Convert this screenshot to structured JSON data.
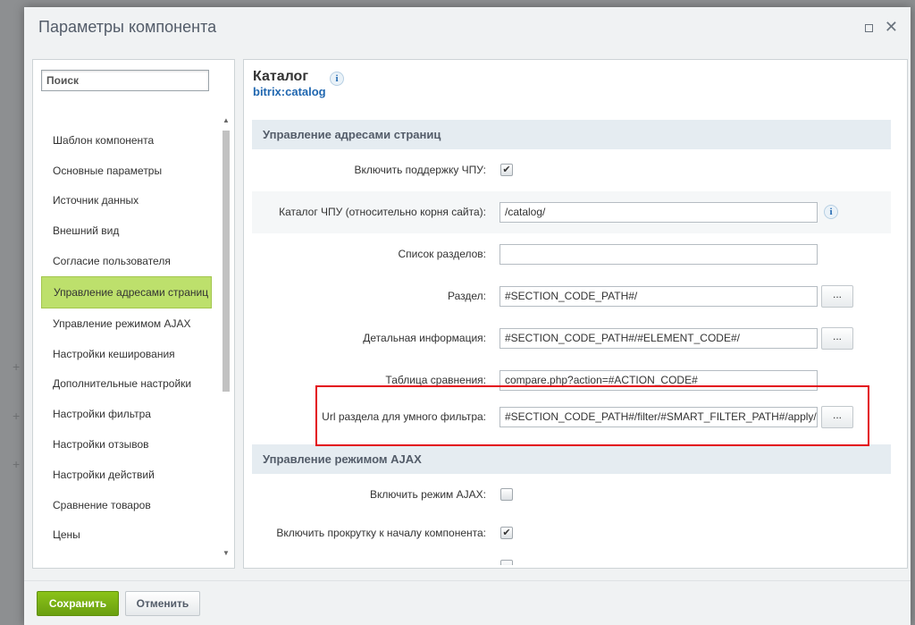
{
  "dialog": {
    "title": "Параметры компонента"
  },
  "search": {
    "placeholder": "Поиск"
  },
  "sidebar": {
    "items": [
      {
        "label": "Шаблон компонента"
      },
      {
        "label": "Основные параметры"
      },
      {
        "label": "Источник данных"
      },
      {
        "label": "Внешний вид"
      },
      {
        "label": "Согласие пользователя"
      },
      {
        "label": "Управление адресами страниц",
        "active": true
      },
      {
        "label": "Управление режимом AJAX"
      },
      {
        "label": "Настройки кеширования"
      },
      {
        "label": "Дополнительные настройки"
      },
      {
        "label": "Настройки фильтра"
      },
      {
        "label": "Настройки отзывов"
      },
      {
        "label": "Настройки действий"
      },
      {
        "label": "Сравнение товаров"
      },
      {
        "label": "Цены"
      }
    ]
  },
  "component": {
    "name": "Каталог",
    "code": "bitrix:catalog"
  },
  "sections": [
    {
      "title": "Управление адресами страниц",
      "rows": [
        {
          "label": "Включить поддержку ЧПУ:",
          "type": "checkbox",
          "checked": true
        },
        {
          "label": "Каталог ЧПУ (относительно корня сайта):",
          "type": "text",
          "value": "/catalog/",
          "info": true
        },
        {
          "label": "Список разделов:",
          "type": "text",
          "value": ""
        },
        {
          "label": "Раздел:",
          "type": "text",
          "value": "#SECTION_CODE_PATH#/",
          "button": "..."
        },
        {
          "label": "Детальная информация:",
          "type": "text",
          "value": "#SECTION_CODE_PATH#/#ELEMENT_CODE#/",
          "button": "..."
        },
        {
          "label": "Таблица сравнения:",
          "type": "text",
          "value": "compare.php?action=#ACTION_CODE#"
        },
        {
          "label": "Url раздела для умного фильтра:",
          "type": "text",
          "value": "#SECTION_CODE_PATH#/filter/#SMART_FILTER_PATH#/apply/",
          "button": "...",
          "highlighted": true
        }
      ]
    },
    {
      "title": "Управление режимом AJAX",
      "rows": [
        {
          "label": "Включить режим AJAX:",
          "type": "checkbox",
          "checked": false
        },
        {
          "label": "Включить прокрутку к началу компонента:",
          "type": "checkbox",
          "checked": true
        }
      ]
    }
  ],
  "footer": {
    "save_label": "Сохранить",
    "cancel_label": "Отменить"
  },
  "colors": {
    "active_nav": "#bde06c",
    "save_button": "#7bb214",
    "link": "#2067b0",
    "highlight": "#e30613"
  }
}
